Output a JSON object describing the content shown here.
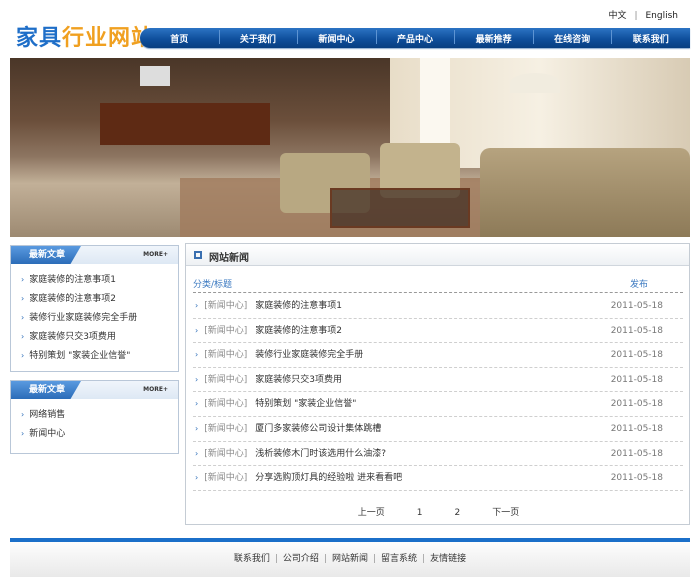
{
  "header": {
    "logo_part1": "家具",
    "logo_part2": "行业网站",
    "lang": [
      "中文",
      "English"
    ],
    "nav": [
      "首页",
      "关于我们",
      "新闻中心",
      "产品中心",
      "最新推荐",
      "在线咨询",
      "联系我们"
    ]
  },
  "sidebar": {
    "box1": {
      "title": "最新文章",
      "more": "MORE+",
      "items": [
        "家庭装修的注意事项1",
        "家庭装修的注意事项2",
        "装修行业家庭装修完全手册",
        "家庭装修只交3项费用",
        "特别策划 \"家装企业信誉\""
      ]
    },
    "box2": {
      "title": "最新文章",
      "more": "MORE+",
      "items": [
        "网络销售",
        "新闻中心"
      ]
    }
  },
  "main": {
    "title": "网站新闻",
    "col_category_title": "分类/标题",
    "col_date": "发布",
    "rows": [
      {
        "cat": "[新闻中心]",
        "title": "家庭装修的注意事项1",
        "date": "2011-05-18"
      },
      {
        "cat": "[新闻中心]",
        "title": "家庭装修的注意事项2",
        "date": "2011-05-18"
      },
      {
        "cat": "[新闻中心]",
        "title": "装修行业家庭装修完全手册",
        "date": "2011-05-18"
      },
      {
        "cat": "[新闻中心]",
        "title": "家庭装修只交3项费用",
        "date": "2011-05-18"
      },
      {
        "cat": "[新闻中心]",
        "title": "特别策划 \"家装企业信誉\"",
        "date": "2011-05-18"
      },
      {
        "cat": "[新闻中心]",
        "title": "厦门多家装修公司设计集体跳槽",
        "date": "2011-05-18"
      },
      {
        "cat": "[新闻中心]",
        "title": "浅析装修木门时该选用什么油漆?",
        "date": "2011-05-18"
      },
      {
        "cat": "[新闻中心]",
        "title": "分享选购顶灯具的经验啦 进来看看吧",
        "date": "2011-05-18"
      }
    ],
    "pager": [
      "上一页",
      "1",
      "2",
      "下一页"
    ]
  },
  "footer": {
    "links": [
      "联系我们",
      "公司介绍",
      "网站新闻",
      "留言系统",
      "友情链接"
    ]
  },
  "colors": {
    "brand_blue": "#1e6ec8",
    "logo_orange": "#f0a020",
    "nav_blue": "#0f4f9c"
  }
}
